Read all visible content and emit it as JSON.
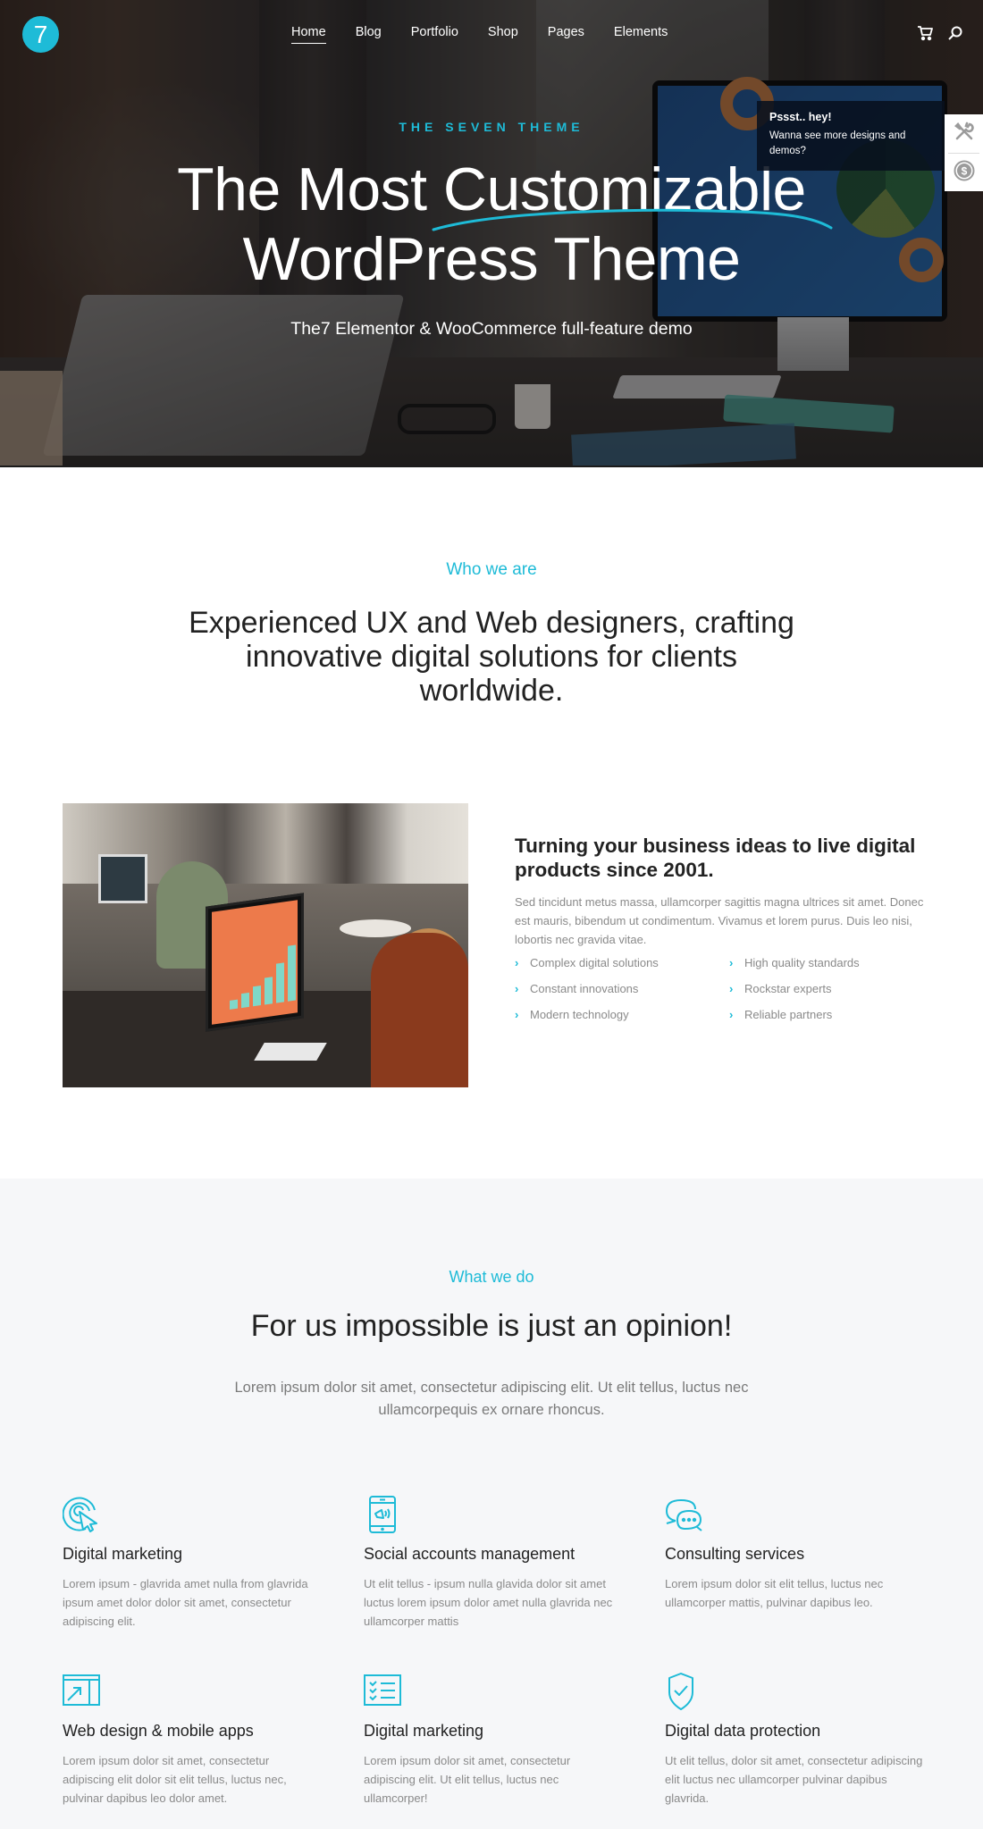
{
  "header": {
    "logo": "7",
    "nav": [
      {
        "label": "Home",
        "active": true
      },
      {
        "label": "Blog"
      },
      {
        "label": "Portfolio"
      },
      {
        "label": "Shop"
      },
      {
        "label": "Pages"
      },
      {
        "label": "Elements"
      }
    ],
    "icons": [
      "cart-icon",
      "search-icon"
    ]
  },
  "hero": {
    "eyebrow": "THE SEVEN THEME",
    "title_line1": "The Most Customizable",
    "title_line2": "WordPress Theme",
    "subtitle": "The7 Elementor & WooCommerce full-feature demo"
  },
  "promo": {
    "title": "Pssst.. hey!",
    "text": "Wanna see more designs and demos?"
  },
  "side_panel": {
    "icons": [
      "tools-icon",
      "dollar-coin-icon"
    ]
  },
  "who": {
    "label": "Who we are",
    "headline": "Experienced UX and Web designers, crafting innovative digital solutions for clients worldwide.",
    "subhead": "Turning your business ideas to live digital products since 2001.",
    "paragraph": "Sed tincidunt metus massa, ullamcorper sagittis magna ultrices sit amet. Donec est mauris, bibendum ut condimentum. Vivamus et lorem purus. Duis leo nisi, lobortis nec gravida vitae.",
    "features": [
      "Complex digital solutions",
      "High quality standards",
      "Constant innovations",
      "Rockstar experts",
      "Modern technology",
      "Reliable partners"
    ]
  },
  "what": {
    "label": "What we do",
    "headline": "For us impossible is just an opinion!",
    "intro": "Lorem ipsum dolor sit amet, consectetur adipiscing elit. Ut elit tellus, luctus nec ullamcorpequis ex ornare rhoncus.",
    "services": [
      {
        "icon": "target-cursor-icon",
        "title": "Digital marketing",
        "text": "Lorem ipsum - glavrida amet nulla from glavrida ipsum amet dolor dolor sit amet, consectetur adipiscing elit."
      },
      {
        "icon": "mobile-megaphone-icon",
        "title": "Social accounts management",
        "text": "Ut elit tellus - ipsum nulla glavida dolor sit amet luctus lorem ipsum dolor amet nulla glavrida nec ullamcorper mattis"
      },
      {
        "icon": "chat-bubbles-icon",
        "title": "Consulting services",
        "text": "Lorem ipsum dolor sit elit tellus, luctus nec ullamcorper mattis, pulvinar dapibus leo."
      },
      {
        "icon": "window-arrow-icon",
        "title": "Web design & mobile apps",
        "text": "Lorem ipsum dolor sit amet, consectetur adipiscing elit dolor sit elit tellus, luctus nec, pulvinar dapibus leo dolor amet."
      },
      {
        "icon": "checklist-icon",
        "title": "Digital marketing",
        "text": "Lorem ipsum dolor sit amet, consectetur adipiscing elit. Ut elit tellus, luctus nec ullamcorper!"
      },
      {
        "icon": "shield-check-icon",
        "title": "Digital data protection",
        "text": "Ut elit tellus, dolor sit amet, consectetur adipiscing elit luctus nec ullamcorper  pulvinar dapibus glavrida."
      }
    ]
  },
  "colors": {
    "accent": "#1ebbd7",
    "section_alt_bg": "#f6f7f9",
    "body_text": "#8a8a8a",
    "heading_text": "#222222"
  }
}
